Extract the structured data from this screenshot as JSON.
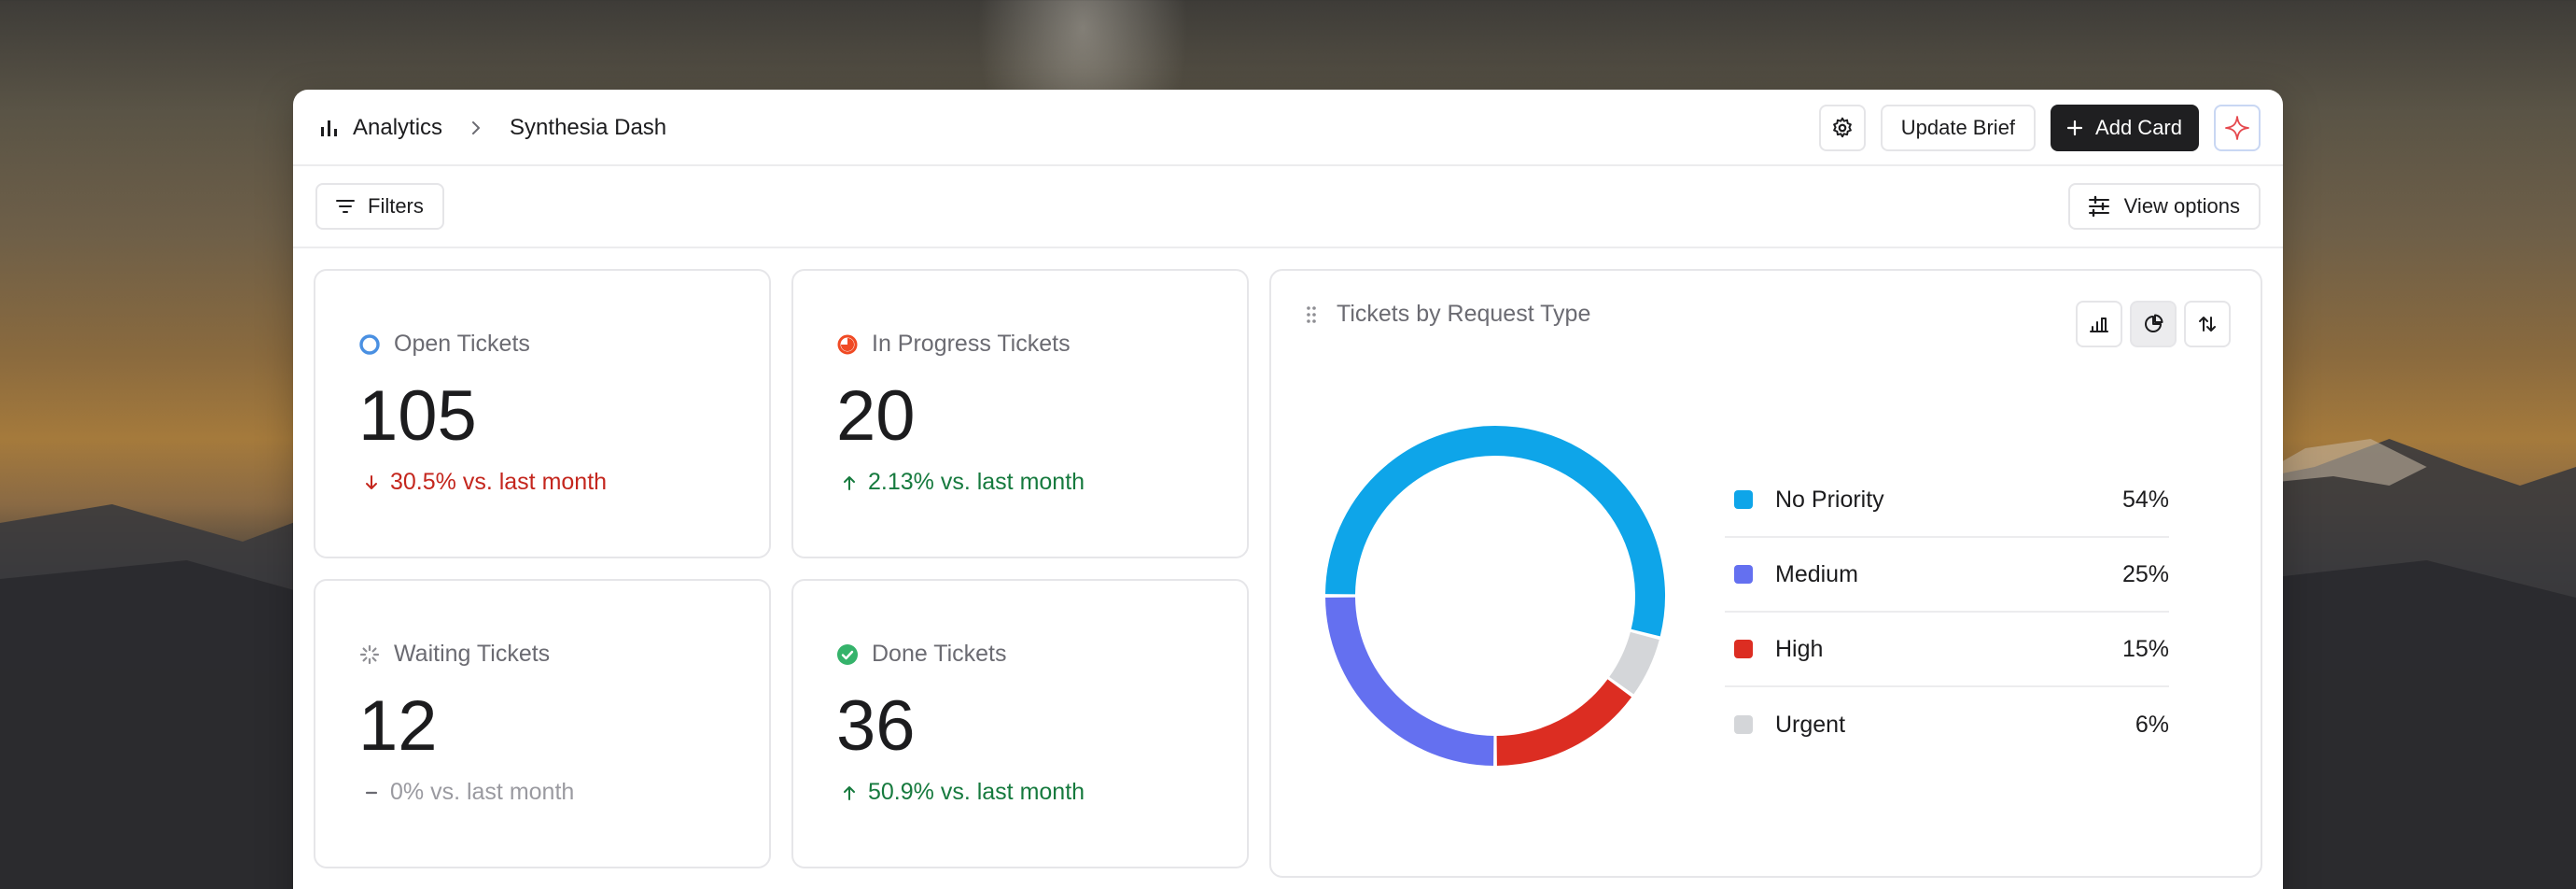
{
  "header": {
    "breadcrumb_root": "Analytics",
    "breadcrumb_current": "Synthesia Dash",
    "update_brief_label": "Update Brief",
    "add_card_label": "Add Card"
  },
  "toolbar": {
    "filters_label": "Filters",
    "view_options_label": "View options"
  },
  "stats": {
    "open": {
      "title": "Open Tickets",
      "value": "105",
      "change": "30.5% vs. last month",
      "trend": "down",
      "icon": "circle-outline-icon",
      "color": "#4a90e2"
    },
    "in_progress": {
      "title": "In Progress Tickets",
      "value": "20",
      "change": "2.13% vs. last month",
      "trend": "up",
      "icon": "half-circle-icon",
      "color": "#f04a24"
    },
    "waiting": {
      "title": "Waiting Tickets",
      "value": "12",
      "change": "0% vs. last month",
      "trend": "flat",
      "icon": "loader-icon",
      "color": "#8e8e93"
    },
    "done": {
      "title": "Done Tickets",
      "value": "36",
      "change": "50.9% vs. last month",
      "trend": "up",
      "icon": "check-circle-icon",
      "color": "#35b36b"
    }
  },
  "request_chart": {
    "title": "Tickets by Request Type",
    "view_selected": "pie",
    "legend": [
      {
        "label": "No Priority",
        "pct": "54%",
        "color": "#0ea5e9"
      },
      {
        "label": "Medium",
        "pct": "25%",
        "color": "#6470f0"
      },
      {
        "label": "High",
        "pct": "15%",
        "color": "#dc2d22"
      },
      {
        "label": "Urgent",
        "pct": "6%",
        "color": "#d4d6d9"
      }
    ]
  },
  "chart_data": {
    "type": "pie",
    "title": "Tickets by Request Type",
    "categories": [
      "No Priority",
      "Medium",
      "High",
      "Urgent"
    ],
    "values": [
      54,
      25,
      15,
      6
    ],
    "colors": [
      "#0ea5e9",
      "#6470f0",
      "#dc2d22",
      "#d4d6d9"
    ],
    "legend": "right"
  },
  "colors": {
    "accent_dark": "#1f1f21",
    "down": "#c4261d",
    "up": "#167a3e"
  }
}
